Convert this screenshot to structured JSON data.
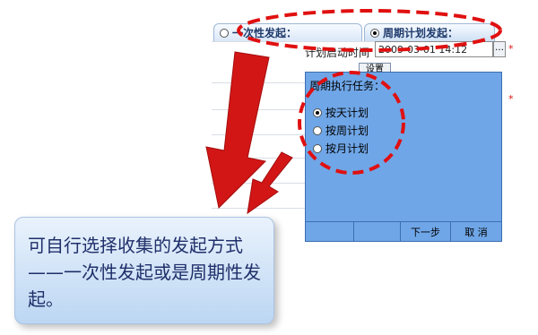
{
  "tabs": [
    {
      "label": "一次性发起：",
      "selected": false
    },
    {
      "label": "周期计划发起：",
      "selected": true
    }
  ],
  "form": {
    "start_time_label": "计划启动时间",
    "start_time_value": "2009-03-01 14:12",
    "browse_label": "…",
    "setup_button_label": "设置",
    "required_mark": "*"
  },
  "panel": {
    "title": "周期执行任务：",
    "options": [
      {
        "label": "按天计划",
        "selected": true
      },
      {
        "label": "按周计划",
        "selected": false
      },
      {
        "label": "按月计划",
        "selected": false
      }
    ],
    "next_label": "下一步",
    "cancel_label": "取 消"
  },
  "callout": {
    "text": "可自行选择收集的发起方式——一次性发起或是周期性发起。"
  },
  "colors": {
    "accent_red": "#e01010",
    "panel_blue": "#6fa6e7"
  }
}
